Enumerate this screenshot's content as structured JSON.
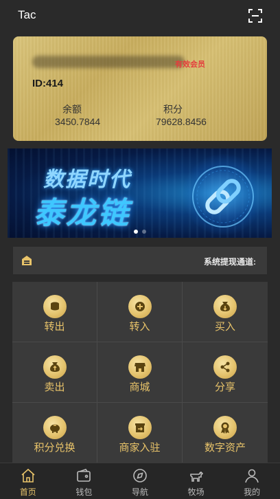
{
  "header": {
    "title": "Tac",
    "scan_icon": "scan-icon"
  },
  "card": {
    "email": "blurred",
    "member_badge": "有效会员",
    "user_id": "ID:414",
    "balance_label": "余额",
    "balance_value": "3450.7844",
    "points_label": "积分",
    "points_value": "79628.8456"
  },
  "banner": {
    "line1": "数据时代",
    "line2": "泰龙链",
    "slide_count": 2,
    "active_slide": 0
  },
  "notice": {
    "icon": "announcement-icon",
    "text": "系统提现通道:"
  },
  "actions": [
    {
      "label": "转出",
      "icon": "transfer-out-icon"
    },
    {
      "label": "转入",
      "icon": "transfer-in-icon"
    },
    {
      "label": "买入",
      "icon": "buy-icon"
    },
    {
      "label": "卖出",
      "icon": "sell-icon"
    },
    {
      "label": "商城",
      "icon": "shop-icon"
    },
    {
      "label": "分享",
      "icon": "share-icon"
    },
    {
      "label": "积分兑换",
      "icon": "piggy-bank-icon"
    },
    {
      "label": "商家入驻",
      "icon": "merchant-icon"
    },
    {
      "label": "数字资产",
      "icon": "award-icon"
    }
  ],
  "tabs": [
    {
      "label": "首页",
      "icon": "home-icon",
      "active": true
    },
    {
      "label": "钱包",
      "icon": "wallet-icon",
      "active": false
    },
    {
      "label": "导航",
      "icon": "compass-icon",
      "active": false
    },
    {
      "label": "牧场",
      "icon": "ranch-icon",
      "active": false
    },
    {
      "label": "我的",
      "icon": "profile-icon",
      "active": false
    }
  ],
  "colors": {
    "gold": "#e9c46a",
    "background": "#2a2a2a",
    "panel": "#3a3a3a",
    "badge_red": "#e43d3d"
  }
}
